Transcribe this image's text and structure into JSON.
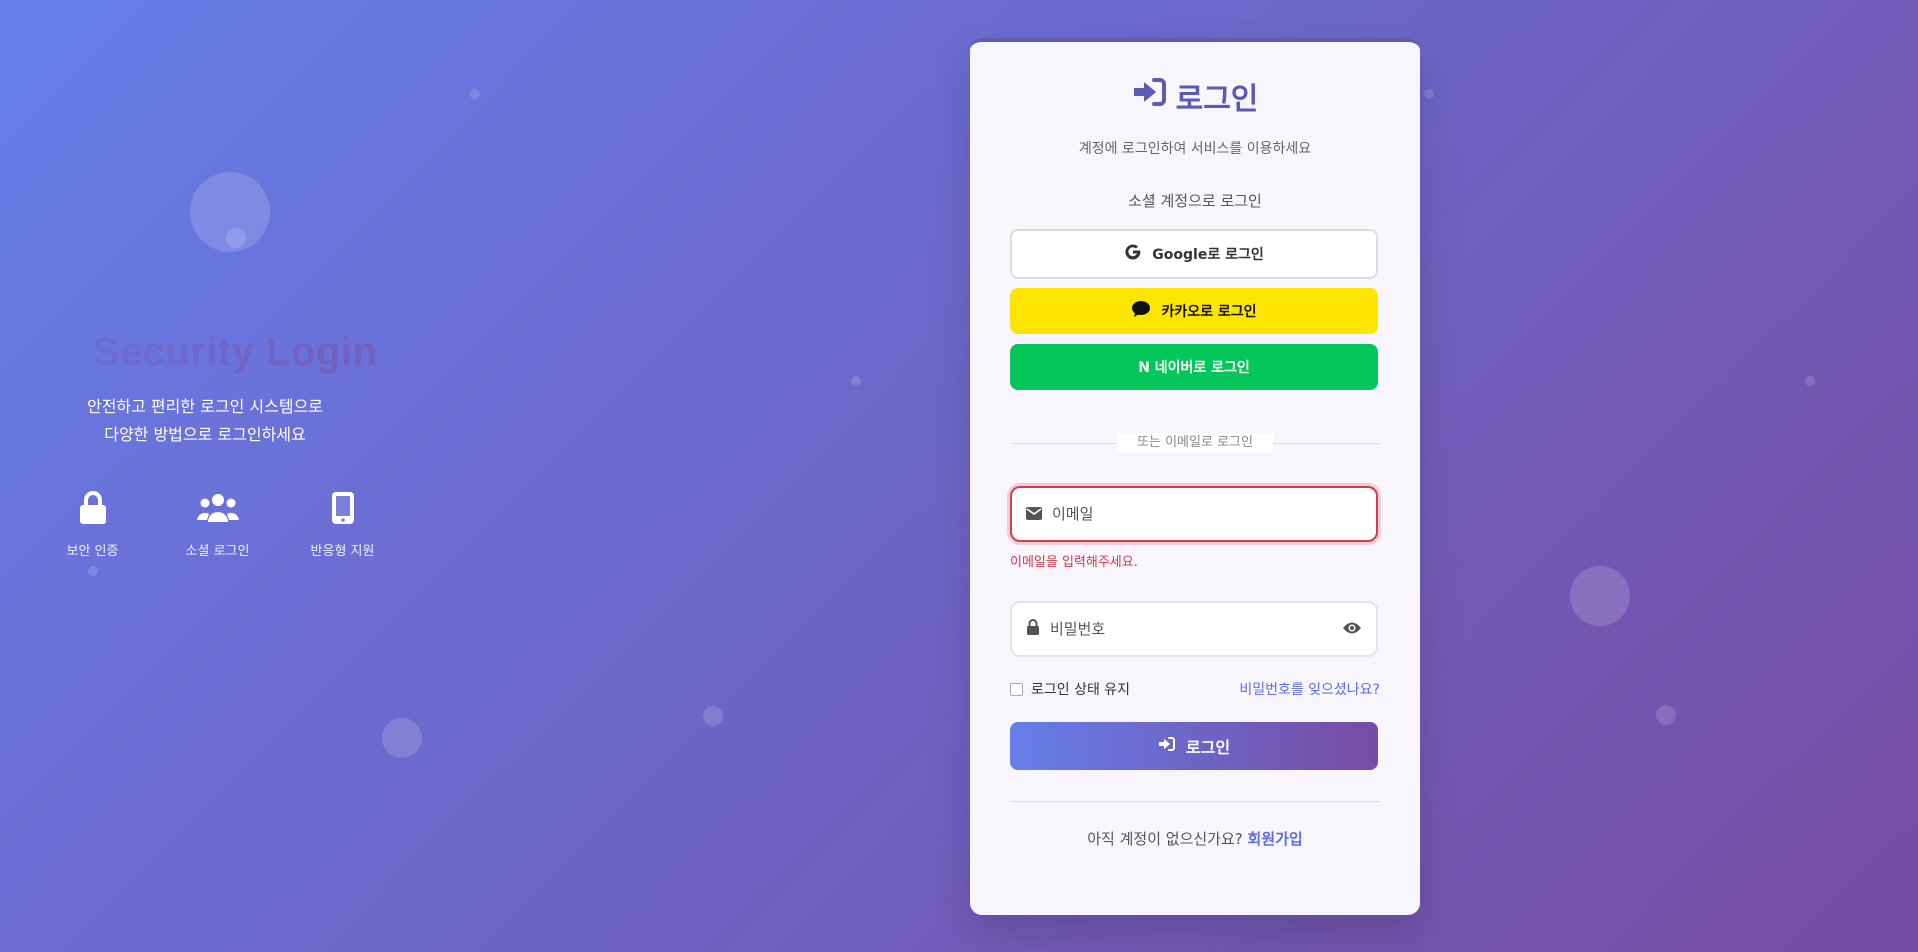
{
  "hero": {
    "title": "Security Login",
    "desc_line1": "안전하고 편리한 로그인 시스템으로",
    "desc_line2": "다양한 방법으로 로그인하세요",
    "features": [
      {
        "icon": "lock-icon",
        "label": "보안 인증"
      },
      {
        "icon": "users-icon",
        "label": "소셜 로그인"
      },
      {
        "icon": "mobile-icon",
        "label": "반응형 지원"
      }
    ]
  },
  "card": {
    "title": "로그인",
    "subtitle": "계정에 로그인하여 서비스를 이용하세요",
    "social_heading": "소셜 계정으로 로그인",
    "google_label": "Google로 로그인",
    "kakao_label": "카카오로 로그인",
    "naver_label": "N 네이버로 로그인",
    "divider_label": "또는 이메일로 로그인",
    "email": {
      "placeholder": "이메일",
      "value": "",
      "error": "이메일을 입력해주세요."
    },
    "password": {
      "placeholder": "비밀번호",
      "value": ""
    },
    "remember_label": "로그인 상태 유지",
    "remember_checked": false,
    "forgot_label": "비밀번호를 잊으셨나요?",
    "login_label": "로그인",
    "signup_prompt": "아직 계정이 없으신가요?",
    "signup_link": "회원가입"
  },
  "colors": {
    "accent": "#5b5bb6",
    "error": "#d23b4a",
    "kakao": "#fee500",
    "naver": "#03c75a",
    "gradient_start": "#667eea",
    "gradient_end": "#764ba2"
  }
}
